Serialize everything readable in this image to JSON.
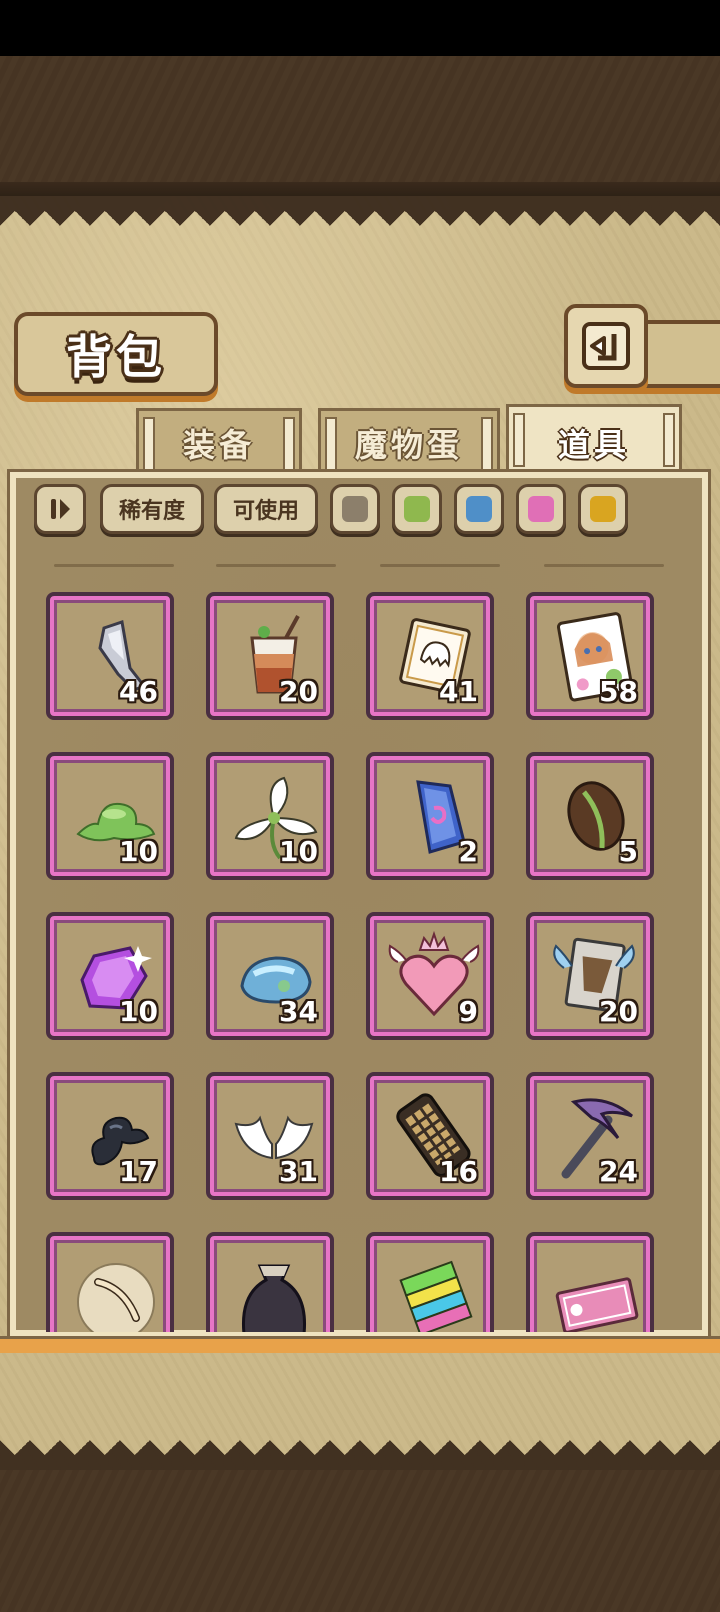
{
  "header": {
    "title": "背包",
    "back_icon": "return-arrow-icon"
  },
  "tabs": [
    {
      "label": "装备",
      "active": false
    },
    {
      "label": "魔物蛋",
      "active": false
    },
    {
      "label": "道具",
      "active": true
    }
  ],
  "filters": {
    "sort_icon": "sort-toggle-icon",
    "rarity_label": "稀有度",
    "usable_label": "可使用",
    "color_swatches": [
      "#8c7f6b",
      "#8fb84e",
      "#4f8fc8",
      "#e06fb6",
      "#d9a520"
    ]
  },
  "colors": {
    "slot_border": "#e775c7",
    "panel": "#9e8a63",
    "frame": "#e8a24a"
  },
  "items": [
    {
      "icon": "crystal-shard-icon",
      "count": "46"
    },
    {
      "icon": "iced-drink-icon",
      "count": "20"
    },
    {
      "icon": "ghost-card-icon",
      "count": "41"
    },
    {
      "icon": "character-card-icon",
      "count": "58"
    },
    {
      "icon": "green-slime-icon",
      "count": "10"
    },
    {
      "icon": "white-flower-icon",
      "count": "10"
    },
    {
      "icon": "blue-gem-icon",
      "count": "2"
    },
    {
      "icon": "bean-seed-icon",
      "count": "5"
    },
    {
      "icon": "purple-gem-icon",
      "count": "10"
    },
    {
      "icon": "blue-slime-stone-icon",
      "count": "34"
    },
    {
      "icon": "crowned-heart-icon",
      "count": "9"
    },
    {
      "icon": "winged-card-icon",
      "count": "20"
    },
    {
      "icon": "dark-shard-icon",
      "count": "17"
    },
    {
      "icon": "angel-wings-icon",
      "count": "31"
    },
    {
      "icon": "grill-scroll-icon",
      "count": "16"
    },
    {
      "icon": "pickaxe-icon",
      "count": "24"
    },
    {
      "icon": "feather-orb-icon",
      "count": ""
    },
    {
      "icon": "dark-pouch-icon",
      "count": ""
    },
    {
      "icon": "rainbow-block-icon",
      "count": ""
    },
    {
      "icon": "pink-ticket-icon",
      "count": ""
    }
  ]
}
